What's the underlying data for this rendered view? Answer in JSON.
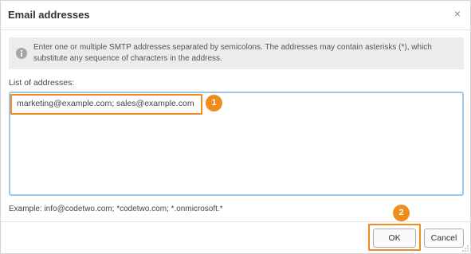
{
  "dialog": {
    "title": "Email addresses",
    "close_glyph": "×"
  },
  "info": {
    "icon": "info-icon",
    "text": "Enter one or multiple SMTP addresses separated by semicolons. The addresses may contain asterisks (*), which substitute any sequence of characters in the address."
  },
  "list": {
    "label": "List of addresses:",
    "value": "marketing@example.com; sales@example.com"
  },
  "example": "Example: info@codetwo.com; *codetwo.com; *.onmicrosoft.*",
  "callouts": [
    "1",
    "2"
  ],
  "buttons": {
    "ok": "OK",
    "cancel": "Cancel"
  },
  "colors": {
    "accent": "#f08c1c",
    "focus_border": "#9ec5ea",
    "info_background": "#ececec"
  }
}
